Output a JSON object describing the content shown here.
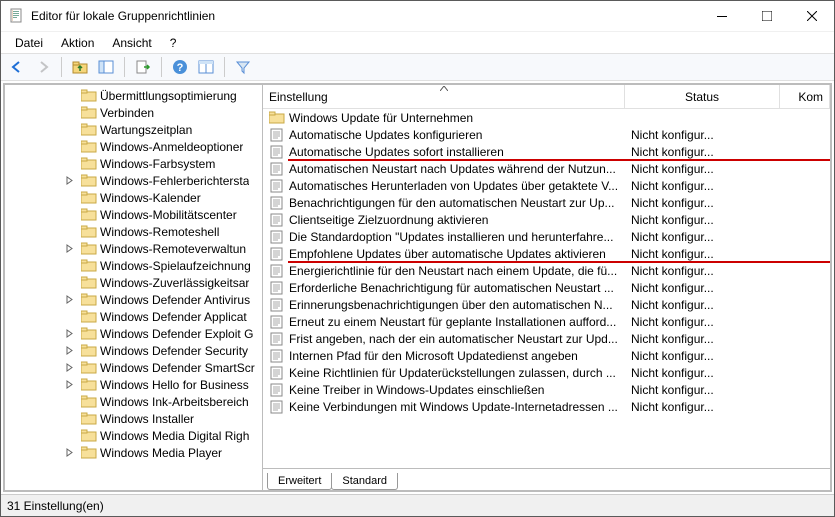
{
  "window": {
    "title": "Editor für lokale Gruppenrichtlinien"
  },
  "menubar": [
    "Datei",
    "Aktion",
    "Ansicht",
    "?"
  ],
  "columns": {
    "setting": "Einstellung",
    "status": "Status",
    "comment": "Kom"
  },
  "tree": [
    {
      "label": "Übermittlungsoptimierung",
      "indent": 4,
      "exp": ""
    },
    {
      "label": "Verbinden",
      "indent": 4,
      "exp": ""
    },
    {
      "label": "Wartungszeitplan",
      "indent": 4,
      "exp": ""
    },
    {
      "label": "Windows-Anmeldeoptioner",
      "indent": 4,
      "exp": ""
    },
    {
      "label": "Windows-Farbsystem",
      "indent": 4,
      "exp": ""
    },
    {
      "label": "Windows-Fehlerberichtersta",
      "indent": 4,
      "exp": ">"
    },
    {
      "label": "Windows-Kalender",
      "indent": 4,
      "exp": ""
    },
    {
      "label": "Windows-Mobilitätscenter",
      "indent": 4,
      "exp": ""
    },
    {
      "label": "Windows-Remoteshell",
      "indent": 4,
      "exp": ""
    },
    {
      "label": "Windows-Remoteverwaltun",
      "indent": 4,
      "exp": ">"
    },
    {
      "label": "Windows-Spielaufzeichnung",
      "indent": 4,
      "exp": ""
    },
    {
      "label": "Windows-Zuverlässigkeitsar",
      "indent": 4,
      "exp": ""
    },
    {
      "label": "Windows Defender Antivirus",
      "indent": 4,
      "exp": ">"
    },
    {
      "label": "Windows Defender Applicat",
      "indent": 4,
      "exp": ""
    },
    {
      "label": "Windows Defender Exploit G",
      "indent": 4,
      "exp": ">"
    },
    {
      "label": "Windows Defender Security",
      "indent": 4,
      "exp": ">"
    },
    {
      "label": "Windows Defender SmartScr",
      "indent": 4,
      "exp": ">"
    },
    {
      "label": "Windows Hello for Business",
      "indent": 4,
      "exp": ">"
    },
    {
      "label": "Windows Ink-Arbeitsbereich",
      "indent": 4,
      "exp": ""
    },
    {
      "label": "Windows Installer",
      "indent": 4,
      "exp": ""
    },
    {
      "label": "Windows Media Digital Righ",
      "indent": 4,
      "exp": ""
    },
    {
      "label": "Windows Media Player",
      "indent": 4,
      "exp": ">"
    }
  ],
  "list": [
    {
      "name": "Windows Update für Unternehmen",
      "status": "",
      "folder": true
    },
    {
      "name": "Automatische Updates konfigurieren",
      "status": "Nicht konfigur..."
    },
    {
      "name": "Automatische Updates sofort installieren",
      "status": "Nicht konfigur...",
      "hl": true
    },
    {
      "name": "Automatischen Neustart nach Updates während der Nutzun...",
      "status": "Nicht konfigur..."
    },
    {
      "name": "Automatisches Herunterladen von Updates über getaktete V...",
      "status": "Nicht konfigur..."
    },
    {
      "name": "Benachrichtigungen für den automatischen Neustart zur Up...",
      "status": "Nicht konfigur..."
    },
    {
      "name": "Clientseitige Zielzuordnung aktivieren",
      "status": "Nicht konfigur..."
    },
    {
      "name": "Die Standardoption \"Updates installieren und herunterfahre...",
      "status": "Nicht konfigur..."
    },
    {
      "name": "Empfohlene Updates über automatische Updates aktivieren",
      "status": "Nicht konfigur...",
      "hl": true
    },
    {
      "name": "Energierichtlinie für den Neustart nach einem Update, die fü...",
      "status": "Nicht konfigur..."
    },
    {
      "name": "Erforderliche Benachrichtigung für automatischen Neustart ...",
      "status": "Nicht konfigur..."
    },
    {
      "name": "Erinnerungsbenachrichtigungen über den automatischen N...",
      "status": "Nicht konfigur..."
    },
    {
      "name": "Erneut zu einem Neustart für geplante Installationen aufford...",
      "status": "Nicht konfigur..."
    },
    {
      "name": "Frist angeben, nach der ein automatischer Neustart zur Upd...",
      "status": "Nicht konfigur..."
    },
    {
      "name": "Internen Pfad für den Microsoft Updatedienst angeben",
      "status": "Nicht konfigur..."
    },
    {
      "name": "Keine Richtlinien für Updaterückstellungen zulassen, durch ...",
      "status": "Nicht konfigur..."
    },
    {
      "name": "Keine Treiber in Windows-Updates einschließen",
      "status": "Nicht konfigur..."
    },
    {
      "name": "Keine Verbindungen mit Windows Update-Internetadressen ...",
      "status": "Nicht konfigur..."
    }
  ],
  "tabs": {
    "extended": "Erweitert",
    "standard": "Standard"
  },
  "status": "31 Einstellung(en)"
}
